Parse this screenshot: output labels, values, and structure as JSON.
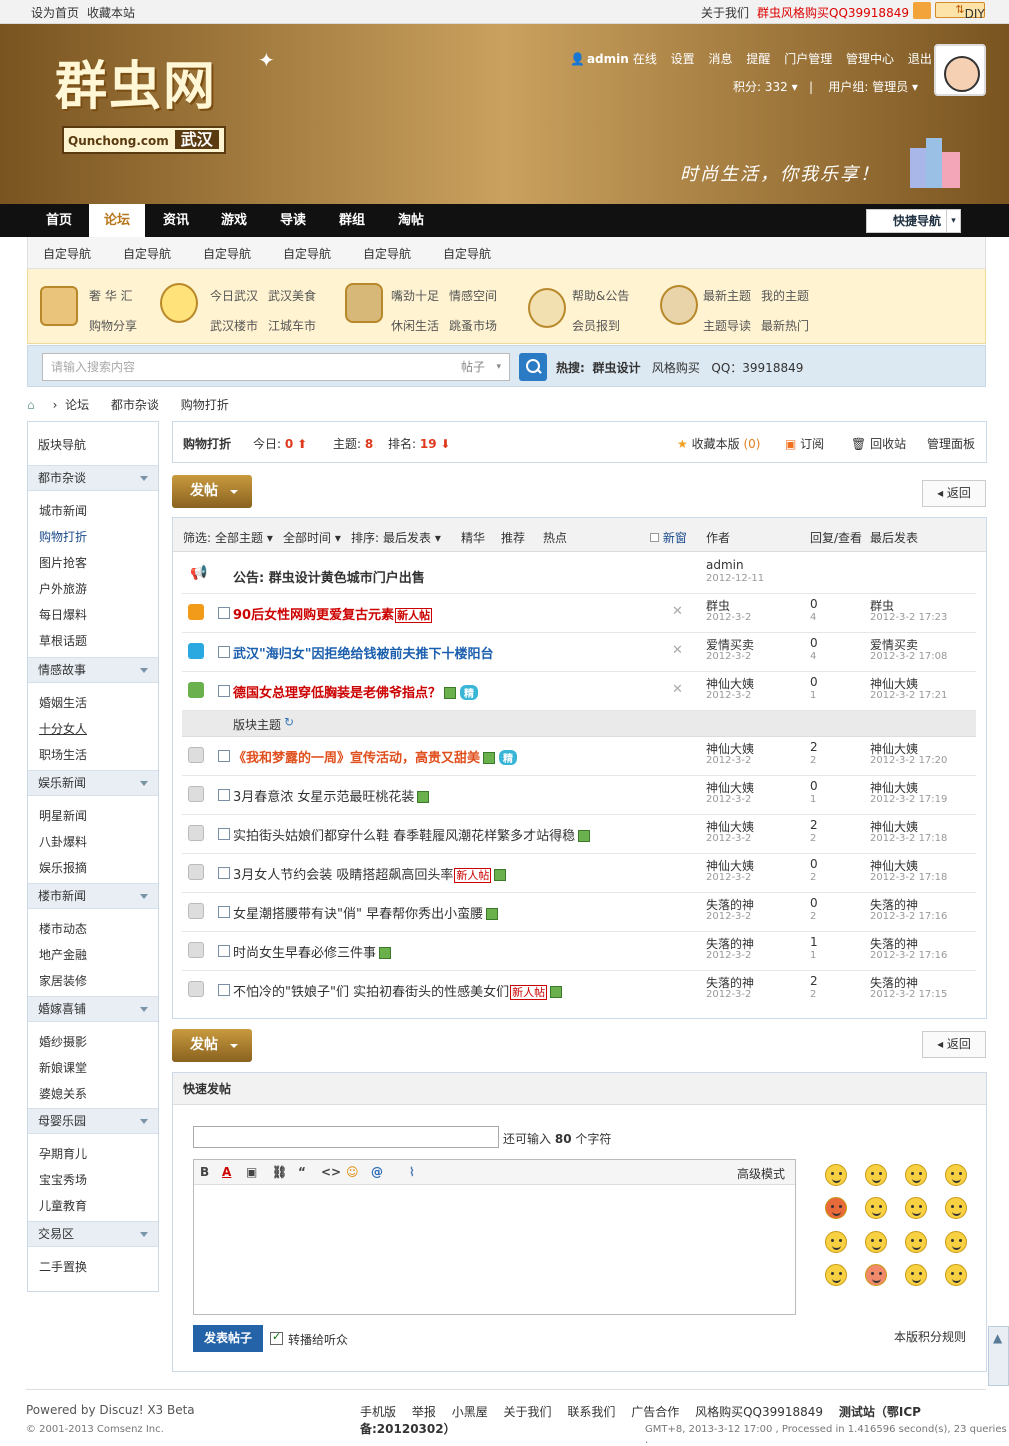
{
  "topbar": {
    "set_home": "设为首页",
    "bookmark": "收藏本站",
    "about": "关于我们",
    "promo": "群虫风格购买QQ39918849",
    "diy": "DIY"
  },
  "header": {
    "logo": "群虫网",
    "logo_sub": "Qunchong.com",
    "logo_city": "武汉",
    "slogan": "时尚生活，你我乐享！",
    "user": "admin",
    "online": "在线",
    "links": [
      "设置",
      "消息",
      "提醒",
      "门户管理",
      "管理中心",
      "退出"
    ],
    "points": "积分: 332",
    "group": "用户组: 管理员"
  },
  "nav": {
    "items": [
      "首页",
      "论坛",
      "资讯",
      "游戏",
      "导读",
      "群组",
      "淘帖"
    ],
    "active": 1,
    "quick": "快捷导航"
  },
  "subnav": [
    "自定导航",
    "自定导航",
    "自定导航",
    "自定导航",
    "自定导航",
    "自定导航"
  ],
  "categories": [
    {
      "links": [
        "奢 华 汇",
        "购物分享"
      ]
    },
    {
      "links": [
        "今日武汉",
        "汉美食",
        "武汉楼市",
        "江城车市"
      ]
    },
    {
      "links": [
        "嘴劲十足",
        "情感空间",
        "休闲生活",
        "跳蚤市场"
      ]
    },
    {
      "links": [
        "帮助&公告",
        "会员报到"
      ]
    },
    {
      "links": [
        "最新主题",
        "我的主题",
        "主题导读",
        "最新热门"
      ]
    }
  ],
  "search": {
    "placeholder": "请输入搜索内容",
    "type": "帖子",
    "hot_label": "热搜:",
    "hot": [
      "群虫设计",
      "风格购买",
      "QQ：39918849"
    ]
  },
  "breadcrumb": [
    "论坛",
    "都市杂谈",
    "购物打折"
  ],
  "sidebar": {
    "title": "版块导航",
    "groups": [
      {
        "name": "都市杂谈",
        "items": [
          "城市新闻",
          "购物打折",
          "图片抢客",
          "户外旅游",
          "每日爆料",
          "草根话题"
        ]
      },
      {
        "name": "情感故事",
        "items": [
          "婚姻生活",
          "十分女人",
          "职场生活"
        ]
      },
      {
        "name": "娱乐新闻",
        "items": [
          "明星新闻",
          "八卦爆料",
          "娱乐报摘"
        ]
      },
      {
        "name": "楼市新闻",
        "items": [
          "楼市动态",
          "地产金融",
          "家居装修"
        ]
      },
      {
        "name": "婚嫁喜铺",
        "items": [
          "婚纱摄影",
          "新娘课堂",
          "婆媳关系"
        ]
      },
      {
        "name": "母婴乐园",
        "items": [
          "孕期育儿",
          "宝宝秀场",
          "儿童教育"
        ]
      },
      {
        "name": "交易区",
        "items": [
          "二手置换"
        ]
      }
    ]
  },
  "forum": {
    "name": "购物打折",
    "today_label": "今日:",
    "today": "0",
    "topics_label": "主题:",
    "topics": "8",
    "rank_label": "排名:",
    "rank": "19",
    "fav": "收藏本版",
    "fav_count": "(0)",
    "subscribe": "订阅",
    "recycle": "回收站",
    "admin": "管理面板"
  },
  "buttons": {
    "post": "发帖",
    "back": "返回"
  },
  "filter": {
    "label": "筛选:",
    "all": "全部主题",
    "time": "全部时间",
    "sort_label": "排序:",
    "sort": "最后发表",
    "digest": "精华",
    "recommend": "推荐",
    "hot": "热点",
    "new_window": "新窗",
    "author": "作者",
    "reply_view": "回复/查看",
    "last_post": "最后发表"
  },
  "announcement": {
    "title": "公告: 群虫设计黄色城市门户出售",
    "author": "admin",
    "date": "2012-12-11"
  },
  "sticky": [
    {
      "title": "90后女性网购更爱复古元素",
      "badge": "新人帖",
      "author": "群虫",
      "date": "2012-3-2",
      "replies": "0",
      "views": "4",
      "last": "群虫",
      "ldate": "2012-3-2 17:23"
    },
    {
      "title": "武汉\"海归女\"因拒绝给钱被前夫推下十楼阳台",
      "badge": "",
      "author": "爱情买卖",
      "date": "2012-3-2",
      "replies": "0",
      "views": "4",
      "last": "爱情买卖",
      "ldate": "2012-3-2 17:08"
    },
    {
      "title": "德国女总理穿低胸装是老佛爷指点？",
      "badge": "",
      "author": "神仙大姨",
      "date": "2012-3-2",
      "replies": "0",
      "views": "1",
      "last": "神仙大姨",
      "ldate": "2012-3-2 17:21",
      "jing": "精"
    }
  ],
  "section_label": "版块主题",
  "threads": [
    {
      "title": "《我和梦露的一周》宣传活动，高贵又甜美",
      "author": "神仙大姨",
      "date": "2012-3-2",
      "replies": "2",
      "views": "2",
      "last": "神仙大姨",
      "ldate": "2012-3-2 17:20",
      "jing": "精"
    },
    {
      "title": "3月春意浓 女星示范最旺桃花装",
      "author": "神仙大姨",
      "date": "2012-3-2",
      "replies": "0",
      "views": "1",
      "last": "神仙大姨",
      "ldate": "2012-3-2 17:19"
    },
    {
      "title": "实拍街头姑娘们都穿什么鞋 春季鞋履风潮花样繁多才站得稳",
      "author": "神仙大姨",
      "date": "2012-3-2",
      "replies": "2",
      "views": "2",
      "last": "神仙大姨",
      "ldate": "2012-3-2 17:18"
    },
    {
      "title": "3月女人节约会装 吸睛搭超飙高回头率",
      "badge": "新人帖",
      "author": "神仙大姨",
      "date": "2012-3-2",
      "replies": "0",
      "views": "2",
      "last": "神仙大姨",
      "ldate": "2012-3-2 17:18"
    },
    {
      "title": "女星潮搭腰带有诀\"俏\" 早春帮你秀出小蛮腰",
      "author": "失落的神",
      "date": "2012-3-2",
      "replies": "0",
      "views": "2",
      "last": "失落的神",
      "ldate": "2012-3-2 17:16"
    },
    {
      "title": "时尚女生早春必修三件事",
      "author": "失落的神",
      "date": "2012-3-2",
      "replies": "1",
      "views": "1",
      "last": "失落的神",
      "ldate": "2012-3-2 17:16"
    },
    {
      "title": "不怕冷的\"铁娘子\"们 实拍初春街头的性感美女们",
      "badge": "新人帖",
      "author": "失落的神",
      "date": "2012-3-2",
      "replies": "2",
      "views": "2",
      "last": "失落的神",
      "ldate": "2012-3-2 17:15"
    }
  ],
  "quickpost": {
    "title": "快速发帖",
    "hint_pre": "还可输入",
    "hint_num": "80",
    "hint_post": "个字符",
    "advanced": "高级模式",
    "submit": "发表帖子",
    "share": "转播给听众",
    "rules": "本版积分规则"
  },
  "footer": {
    "powered": "Powered by Discuz! X3 Beta",
    "copyright": "© 2001-2013 Comsenz Inc.",
    "links": [
      "手机版",
      "举报",
      "小黑屋",
      "关于我们",
      "联系我们",
      "广告合作",
      "风格购买QQ39918849",
      "测试站（鄂ICP备:20120302）"
    ],
    "gmt": "GMT+8, 2013-3-12 17:00 , Processed in 1.416596 second(s), 23 queries ."
  },
  "colors": {
    "accent": "#b8761b",
    "link_blue": "#1a4a8a",
    "hot_red": "#e03a1e",
    "sticky_red": "#c00",
    "sticky_blue": "#1b5fae"
  }
}
